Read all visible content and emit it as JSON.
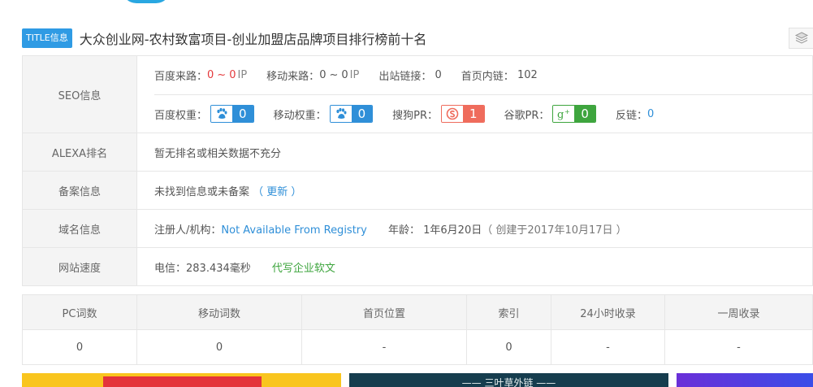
{
  "header": {
    "badge": "TITLE信息",
    "title": "大众创业网-农村致富项目-创业加盟店品牌项目排行榜前十名"
  },
  "seo": {
    "label": "SEO信息",
    "baidu_source_label": "百度来路：",
    "baidu_source_min": "0",
    "baidu_source_sep": "~",
    "baidu_source_max": "0",
    "baidu_source_unit": "IP",
    "mobile_source_label": "移动来路：",
    "mobile_source_min": "0",
    "mobile_source_sep": "~",
    "mobile_source_max": "0",
    "mobile_source_unit": "IP",
    "outbound_label": "出站链接：",
    "outbound_value": "0",
    "homepage_links_label": "首页内链：",
    "homepage_links_value": "102",
    "baidu_weight_label": "百度权重：",
    "baidu_weight_value": "0",
    "mobile_weight_label": "移动权重：",
    "mobile_weight_value": "0",
    "sogou_pr_label": "搜狗PR：",
    "sogou_pr_value": "1",
    "google_pr_label": "谷歌PR：",
    "google_pr_value": "0",
    "backlinks_label": "反链：",
    "backlinks_value": "0"
  },
  "alexa": {
    "label": "ALEXA排名",
    "value": "暂无排名或相关数据不充分"
  },
  "icp": {
    "label": "备案信息",
    "value": "未找到信息或未备案",
    "update_link": "（ 更新 ）"
  },
  "domain": {
    "label": "域名信息",
    "registrant_label": "注册人/机构：",
    "registrant_value": "Not Available From Registry",
    "age_label": "年龄：",
    "age_value": "1年6月20日",
    "created_note": "（ 创建于2017年10月17日 ）"
  },
  "speed": {
    "label": "网站速度",
    "value": "电信：283.434毫秒",
    "ad_link": "代写企业软文"
  },
  "rank_table": {
    "headers": [
      "PC词数",
      "移动词数",
      "首页位置",
      "索引",
      "24小时收录",
      "一周收录"
    ],
    "values": [
      "0",
      "0",
      "-",
      "0",
      "-",
      "-"
    ]
  },
  "banners": {
    "middle_text": "—— 三叶草外链 ——"
  },
  "colors": {
    "accent_blue": "#2f8fd8",
    "badge_blue": "#2f9be4",
    "red": "#e4393c",
    "green": "#3ea53e",
    "sogou_orange": "#ef6c5c"
  }
}
